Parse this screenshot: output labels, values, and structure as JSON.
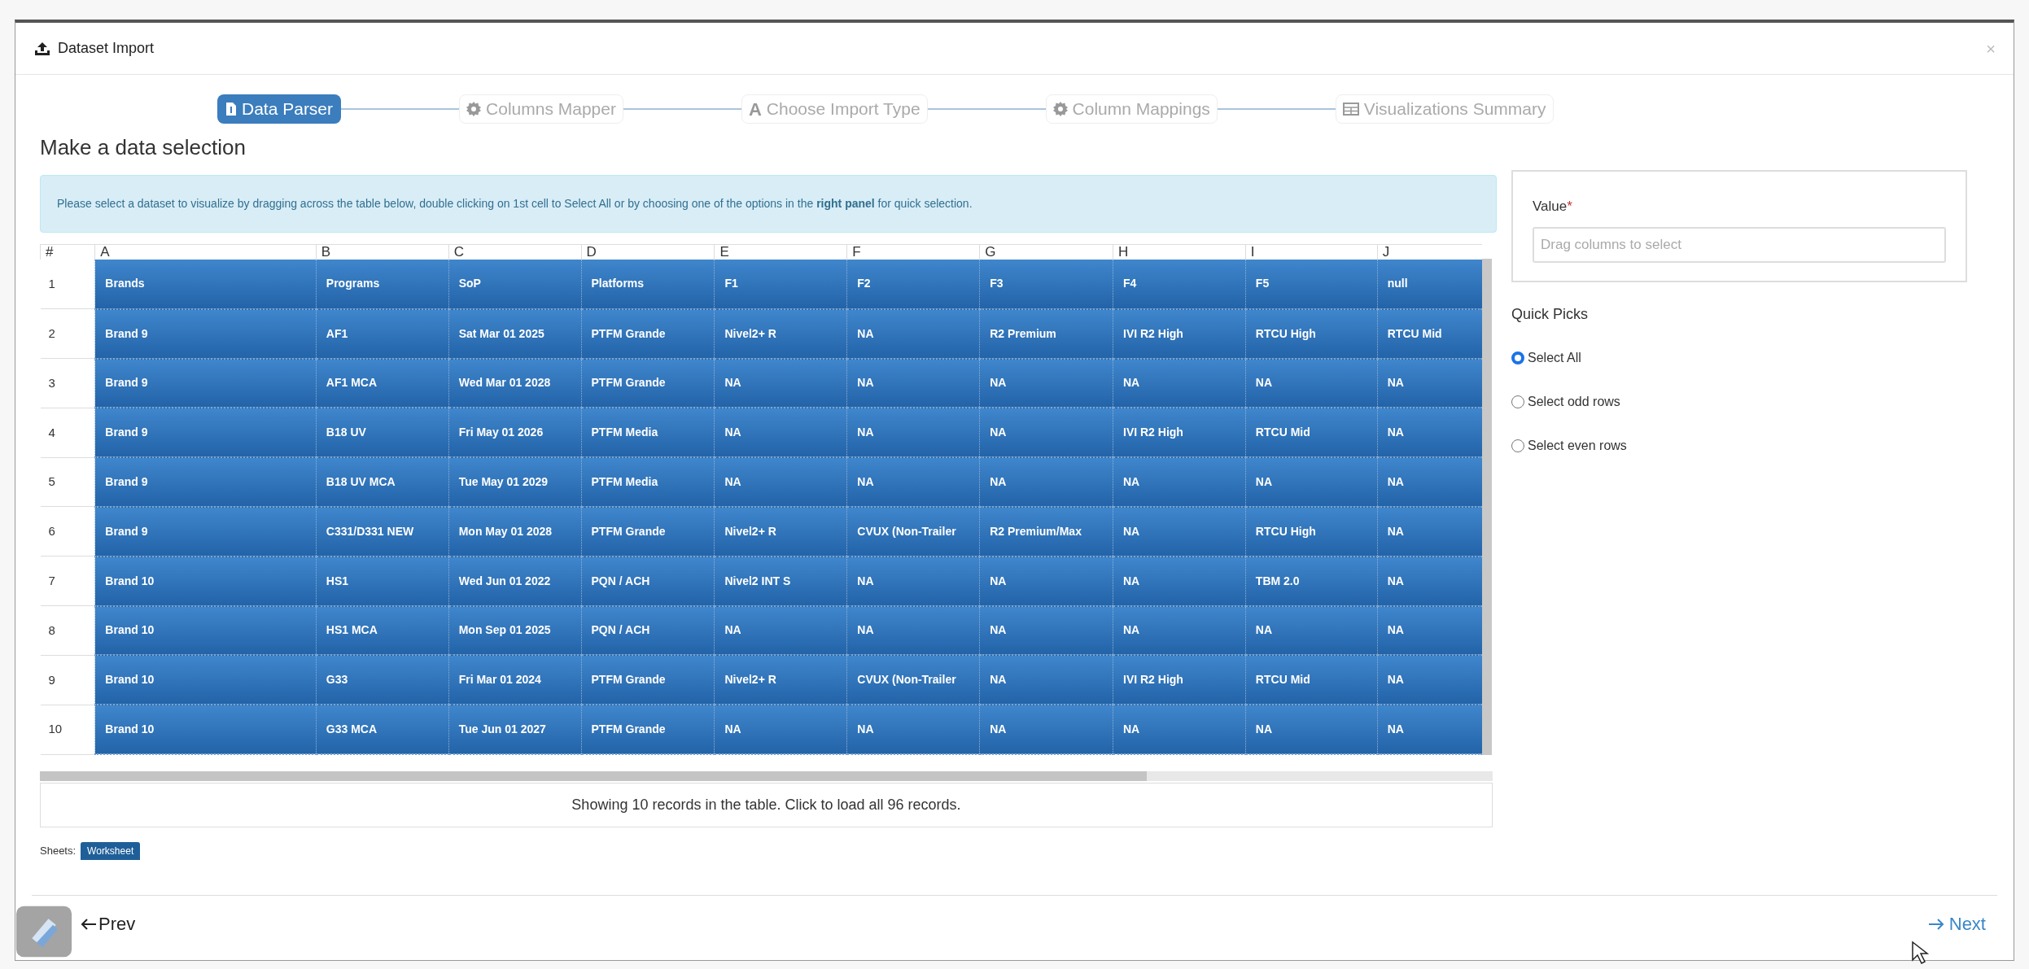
{
  "window": {
    "title": "Dataset Import",
    "close": "×"
  },
  "steps": [
    {
      "label": "Data Parser",
      "kind": "file",
      "selected": true
    },
    {
      "label": "Columns Mapper",
      "kind": "gear",
      "selected": false
    },
    {
      "label": "Choose Import Type",
      "kind": "letter",
      "glyph": "A",
      "selected": false
    },
    {
      "label": "Column Mappings",
      "kind": "gear",
      "selected": false
    },
    {
      "label": "Visualizations Summary",
      "kind": "table",
      "selected": false
    }
  ],
  "heading": "Make a data selection",
  "info": "Please select a dataset to visualize by dragging across the table below, double clicking on 1st cell to Select All or by choosing one of the options in the **right panel** for quick selection.",
  "table": {
    "columns": [
      "#",
      "A",
      "B",
      "C",
      "D",
      "E",
      "F",
      "G",
      "H",
      "I",
      "J"
    ],
    "rows": [
      {
        "selected": true,
        "cells": [
          "1",
          "Brands",
          "Programs",
          "SoP",
          "Platforms",
          "F1",
          "F2",
          "F3",
          "F4",
          "F5",
          "null"
        ]
      },
      {
        "selected": true,
        "cells": [
          "2",
          "Brand 9",
          "AF1",
          "Sat Mar 01 2025",
          "PTFM Grande",
          "Nivel2+ R",
          "NA",
          "R2 Premium",
          "IVI R2 High",
          "RTCU High",
          "RTCU Mid"
        ]
      },
      {
        "selected": true,
        "cells": [
          "3",
          "Brand 9",
          "AF1 MCA",
          "Wed Mar 01 2028",
          "PTFM Grande",
          "NA",
          "NA",
          "NA",
          "NA",
          "NA",
          "NA"
        ]
      },
      {
        "selected": true,
        "cells": [
          "4",
          "Brand 9",
          "B18 UV",
          "Fri May 01 2026",
          "PTFM Media",
          "NA",
          "NA",
          "NA",
          "IVI R2 High",
          "RTCU Mid",
          "NA"
        ]
      },
      {
        "selected": true,
        "cells": [
          "5",
          "Brand 9",
          "B18 UV MCA",
          "Tue May 01 2029",
          "PTFM Media",
          "NA",
          "NA",
          "NA",
          "NA",
          "NA",
          "NA"
        ]
      },
      {
        "selected": true,
        "cells": [
          "6",
          "Brand 9",
          "C331/D331 NEW",
          "Mon May 01 2028",
          "PTFM Grande",
          "Nivel2+ R",
          "CVUX (Non-Trailer",
          "R2 Premium/Max",
          "NA",
          "RTCU High",
          "NA"
        ]
      },
      {
        "selected": true,
        "cells": [
          "7",
          "Brand 10",
          "HS1",
          "Wed Jun 01 2022",
          "PQN / ACH",
          "Nivel2 INT S",
          "NA",
          "NA",
          "NA",
          "TBM 2.0",
          "NA"
        ]
      },
      {
        "selected": true,
        "cells": [
          "8",
          "Brand 10",
          "HS1 MCA",
          "Mon Sep 01 2025",
          "PQN / ACH",
          "NA",
          "NA",
          "NA",
          "NA",
          "NA",
          "NA"
        ]
      },
      {
        "selected": true,
        "cells": [
          "9",
          "Brand 10",
          "G33",
          "Fri Mar 01 2024",
          "PTFM Grande",
          "Nivel2+ R",
          "CVUX (Non-Trailer",
          "NA",
          "IVI R2 High",
          "RTCU Mid",
          "NA"
        ]
      },
      {
        "selected": true,
        "cells": [
          "10",
          "Brand 10",
          "G33 MCA",
          "Tue Jun 01 2027",
          "PTFM Grande",
          "NA",
          "NA",
          "NA",
          "NA",
          "NA",
          "NA"
        ]
      }
    ]
  },
  "records_note": "Showing 10 records in the table. Click to load all 96 records.",
  "sheets": {
    "label": "Sheets:",
    "tabs": [
      {
        "label": "Worksheet",
        "selected": true
      }
    ]
  },
  "value_field": {
    "label": "Value",
    "required_mark": "*",
    "placeholder": "Drag columns to select"
  },
  "quick_picks": {
    "title": "Quick Picks",
    "options": [
      {
        "label": "Select All",
        "selected": true
      },
      {
        "label": "Select odd rows",
        "selected": false
      },
      {
        "label": "Select even rows",
        "selected": false
      }
    ]
  },
  "footer": {
    "prev": "Prev",
    "next": "Next"
  }
}
